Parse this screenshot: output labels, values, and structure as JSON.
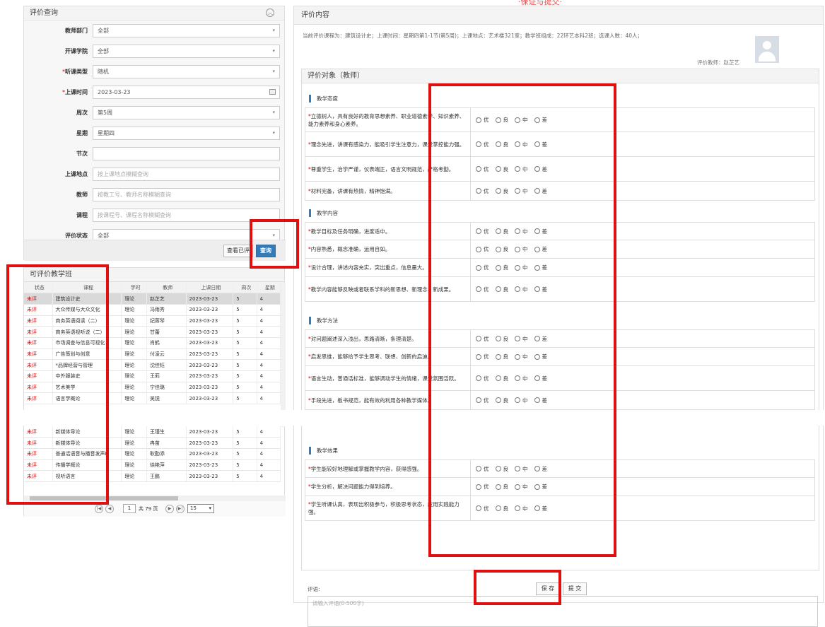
{
  "query_panel": {
    "title": "评价查询",
    "fields": [
      {
        "label": "教师部门",
        "required": false,
        "value": "全部",
        "type": "select"
      },
      {
        "label": "开课学院",
        "required": false,
        "value": "全部",
        "type": "select"
      },
      {
        "label": "听课类型",
        "required": true,
        "value": "随机",
        "type": "select"
      },
      {
        "label": "上课时间",
        "required": true,
        "value": "2023-03-23",
        "type": "date"
      },
      {
        "label": "周次",
        "required": false,
        "value": "第5周",
        "type": "select"
      },
      {
        "label": "星期",
        "required": false,
        "value": "星期四",
        "type": "select"
      },
      {
        "label": "节次",
        "required": false,
        "value": "",
        "type": "text"
      },
      {
        "label": "上课地点",
        "required": false,
        "placeholder": "按上课地点模糊查询",
        "type": "text"
      },
      {
        "label": "教师",
        "required": false,
        "placeholder": "按教工号、教师名称模糊查询",
        "type": "text"
      },
      {
        "label": "课程",
        "required": false,
        "placeholder": "按课程号、课程名称模糊查询",
        "type": "text"
      },
      {
        "label": "评价状态",
        "required": false,
        "value": "全部",
        "type": "select"
      }
    ],
    "view_evaluated_label": "查看已评",
    "search_label": "查询"
  },
  "class_panel": {
    "title": "可评价教学班",
    "columns": [
      "状态",
      "课程",
      "学时",
      "教师",
      "上课日期",
      "周次",
      "星期"
    ],
    "rows_top": [
      [
        "未评",
        "建筑设计史",
        "理论",
        "赵芷艺",
        "2023-03-23",
        "5",
        "4"
      ],
      [
        "未评",
        "大众传媒与大众文化",
        "理论",
        "冯雨秀",
        "2023-03-23",
        "5",
        "4"
      ],
      [
        "未评",
        "商务英语阅读（二）",
        "理论",
        "纪蓉琴",
        "2023-03-23",
        "5",
        "4"
      ],
      [
        "未评",
        "商务英语视听说（二）",
        "理论",
        "甘蕾",
        "2023-03-23",
        "5",
        "4"
      ],
      [
        "未评",
        "市场调查与信息可视化",
        "理论",
        "肖鹤",
        "2023-03-23",
        "5",
        "4"
      ],
      [
        "未评",
        "广告策划与创意",
        "理论",
        "付凌云",
        "2023-03-23",
        "5",
        "4"
      ],
      [
        "未评",
        "*品牌经营与管理",
        "理论",
        "沈佳钰",
        "2023-03-23",
        "5",
        "4"
      ],
      [
        "未评",
        "中外服装史",
        "理论",
        "王莉",
        "2023-03-23",
        "5",
        "4"
      ],
      [
        "未评",
        "艺术美学",
        "理论",
        "宁佳璐",
        "2023-03-23",
        "5",
        "4"
      ],
      [
        "未评",
        "语言学概论",
        "理论",
        "吴锐",
        "2023-03-23",
        "5",
        "4"
      ]
    ],
    "rows_bottom": [
      [
        "未评",
        "新媒体导论",
        "理论",
        "王瑾生",
        "2023-03-23",
        "5",
        "4"
      ],
      [
        "未评",
        "新媒体导论",
        "理论",
        "冉苗",
        "2023-03-23",
        "5",
        "4"
      ],
      [
        "未评",
        "普通话语音与播音发声Ⅱ",
        "理论",
        "耿勤添",
        "2023-03-23",
        "5",
        "4"
      ],
      [
        "未评",
        "传播学概论",
        "理论",
        "徐艳萍",
        "2023-03-23",
        "5",
        "4"
      ],
      [
        "未评",
        "视听语言",
        "理论",
        "王鹏",
        "2023-03-23",
        "5",
        "4"
      ]
    ],
    "pager": {
      "page": "1",
      "total_text": "共 79 页",
      "page_size": "15"
    }
  },
  "eval_panel": {
    "title": "评价内容",
    "info": "当前评价课程为：建筑设计史；上课时间：星期四第1-1节(第5周)；上课地点：艺术楼321室；教学班组成：22环艺本科2班；选课人数：40人；",
    "teacher_label": "评价教师：赵芷艺",
    "object_title": "评价对象（教师）",
    "options": [
      "优",
      "良",
      "中",
      "差"
    ],
    "sections": [
      {
        "title": "教学态度",
        "items": [
          "立德树人，具有良好的教育思想素养、职业道德素养、知识素养、能力素养和身心素养。",
          "理念先进，讲课有感染力，能吸引学生注意力，课堂掌控能力强。",
          "尊重学生，治学严谨，仪表端正，语言文明规范，严格考勤。",
          "材料完备，讲课有热情，精神饱满。"
        ]
      },
      {
        "title": "教学内容",
        "items": [
          "教学目标及任务明确，进度适中。",
          "内容熟悉，概念准确，运用自如。",
          "设计合理，讲述内容充实，突出重点，信息量大。",
          "教学内容能够反映或者联系学科的新思想、新理念、新成果。"
        ]
      },
      {
        "title": "教学方法",
        "items": [
          "对问题阐述深入浅出，思路清晰，条理清楚。",
          "启发思维，能够给予学生思考、联想、创新的启迪。",
          "语言生动，普通话标准，能够调动学生的情绪，课堂氛围活跃。",
          "手段先进，板书规范，能有效的利用各种教学媒体。"
        ]
      },
      {
        "title": "教学效果",
        "items": [
          "学生能较好地理解或掌握教学内容，获得感强。",
          "学生分析，解决问题能力得到培养。",
          "学生听课认真，表现出积极参与，积极思考状态，应用实践能力强。"
        ]
      }
    ],
    "comment_label": "评语:",
    "comment_placeholder": "请输入评语(0-500字)",
    "save_label": "保 存",
    "submit_label": "提 交",
    "top_partial_text": "·保证与提交·"
  },
  "colors": {
    "highlight": "#e01010",
    "accent": "#337ab7",
    "status": "#dd0000"
  }
}
